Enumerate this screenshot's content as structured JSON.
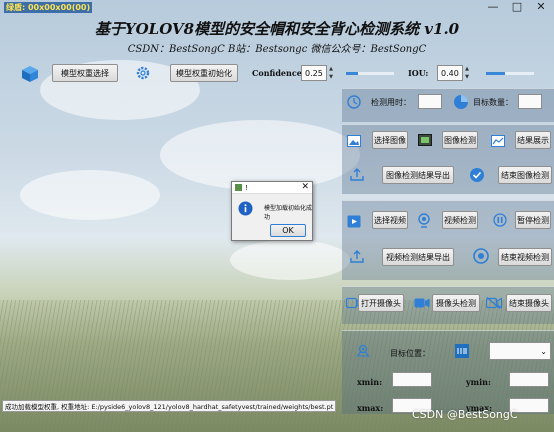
{
  "window": {
    "label": "绿盾: 00x00x00(00)",
    "minimize": "—",
    "maximize": "□",
    "close": "✕"
  },
  "header": {
    "title": "基于YOLOV8模型的安全帽和安全背心检测系统 v1.0",
    "subtitle": "CSDN：BestSongC   B站：Bestsongc   微信公众号：BestSongC"
  },
  "top_controls": {
    "model_select": "模型权重选择",
    "model_init": "模型权重初始化",
    "confidence_label": "Confidence:",
    "confidence_value": "0.25",
    "confidence_level": 0.25,
    "iou_label": "IOU:",
    "iou_value": "0.40",
    "iou_level": 0.4
  },
  "stats": {
    "time_label": "检测用时：",
    "time_value": "",
    "count_label": "目标数量：",
    "count_value": ""
  },
  "image_section": {
    "select": "选择图像",
    "detect": "图像检测",
    "show": "结果展示",
    "export": "图像检测结果导出",
    "end": "结束图像检测"
  },
  "video_section": {
    "select": "选择视频",
    "detect": "视频检测",
    "pause": "暂停检测",
    "export": "视频检测结果导出",
    "end": "结束视频检测"
  },
  "camera_section": {
    "open": "打开摄像头",
    "detect": "摄像头检测",
    "end": "结束摄像头"
  },
  "target_section": {
    "position_label": "目标位置：",
    "select_value": "",
    "xmin": "xmin:",
    "ymin": "ymin:",
    "xmax": "xmax:",
    "ymax": "ymax:"
  },
  "dialog": {
    "title": "!",
    "close": "✕",
    "message": "模型加载初始化成功",
    "ok": "OK"
  },
  "status": {
    "text": "成功加载模型权重, 权重地址: E:/pyside6_yolov8_121/yolov8_hardhat_safetyvest/trained/weights/best.pt"
  },
  "watermark": "CSDN @BestSongC",
  "colors": {
    "accent_blue": "#2f7fd6",
    "panel": "#50698a"
  }
}
